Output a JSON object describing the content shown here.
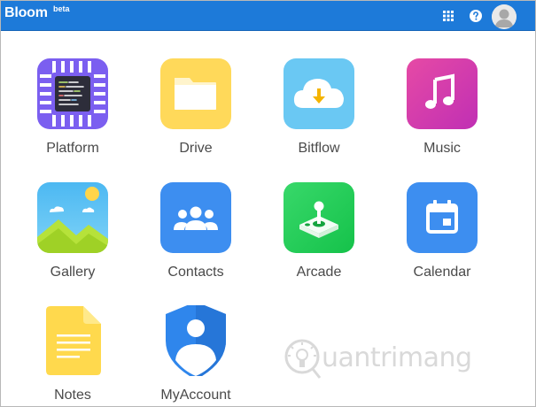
{
  "header": {
    "brand": "Bloom",
    "beta": "beta",
    "background": "#1d7ad9",
    "apps_icon": "apps-grid-icon",
    "help_icon": "help-circle-icon",
    "avatar_icon": "user-avatar-icon"
  },
  "apps": [
    {
      "label": "Platform",
      "icon": "platform-chip-icon",
      "color": "#7b5ff0"
    },
    {
      "label": "Drive",
      "icon": "drive-folder-icon",
      "color": "#ffd95a"
    },
    {
      "label": "Bitflow",
      "icon": "bitflow-cloud-download-icon",
      "color": "#6ac8f3"
    },
    {
      "label": "Music",
      "icon": "music-note-icon",
      "color": "#d42fa8"
    },
    {
      "label": "Gallery",
      "icon": "gallery-landscape-icon",
      "color": "#4db7f0"
    },
    {
      "label": "Contacts",
      "icon": "contacts-people-icon",
      "color": "#3d8ef0"
    },
    {
      "label": "Arcade",
      "icon": "arcade-joystick-icon",
      "color": "#22cc55"
    },
    {
      "label": "Calendar",
      "icon": "calendar-icon",
      "color": "#3d8ef0"
    },
    {
      "label": "Notes",
      "icon": "notes-document-icon",
      "color": "#ffd94d"
    },
    {
      "label": "MyAccount",
      "icon": "myaccount-shield-icon",
      "color": "#2f86ec"
    }
  ],
  "watermark": {
    "text": "uantrimang",
    "icon": "lightbulb-watermark-icon"
  }
}
